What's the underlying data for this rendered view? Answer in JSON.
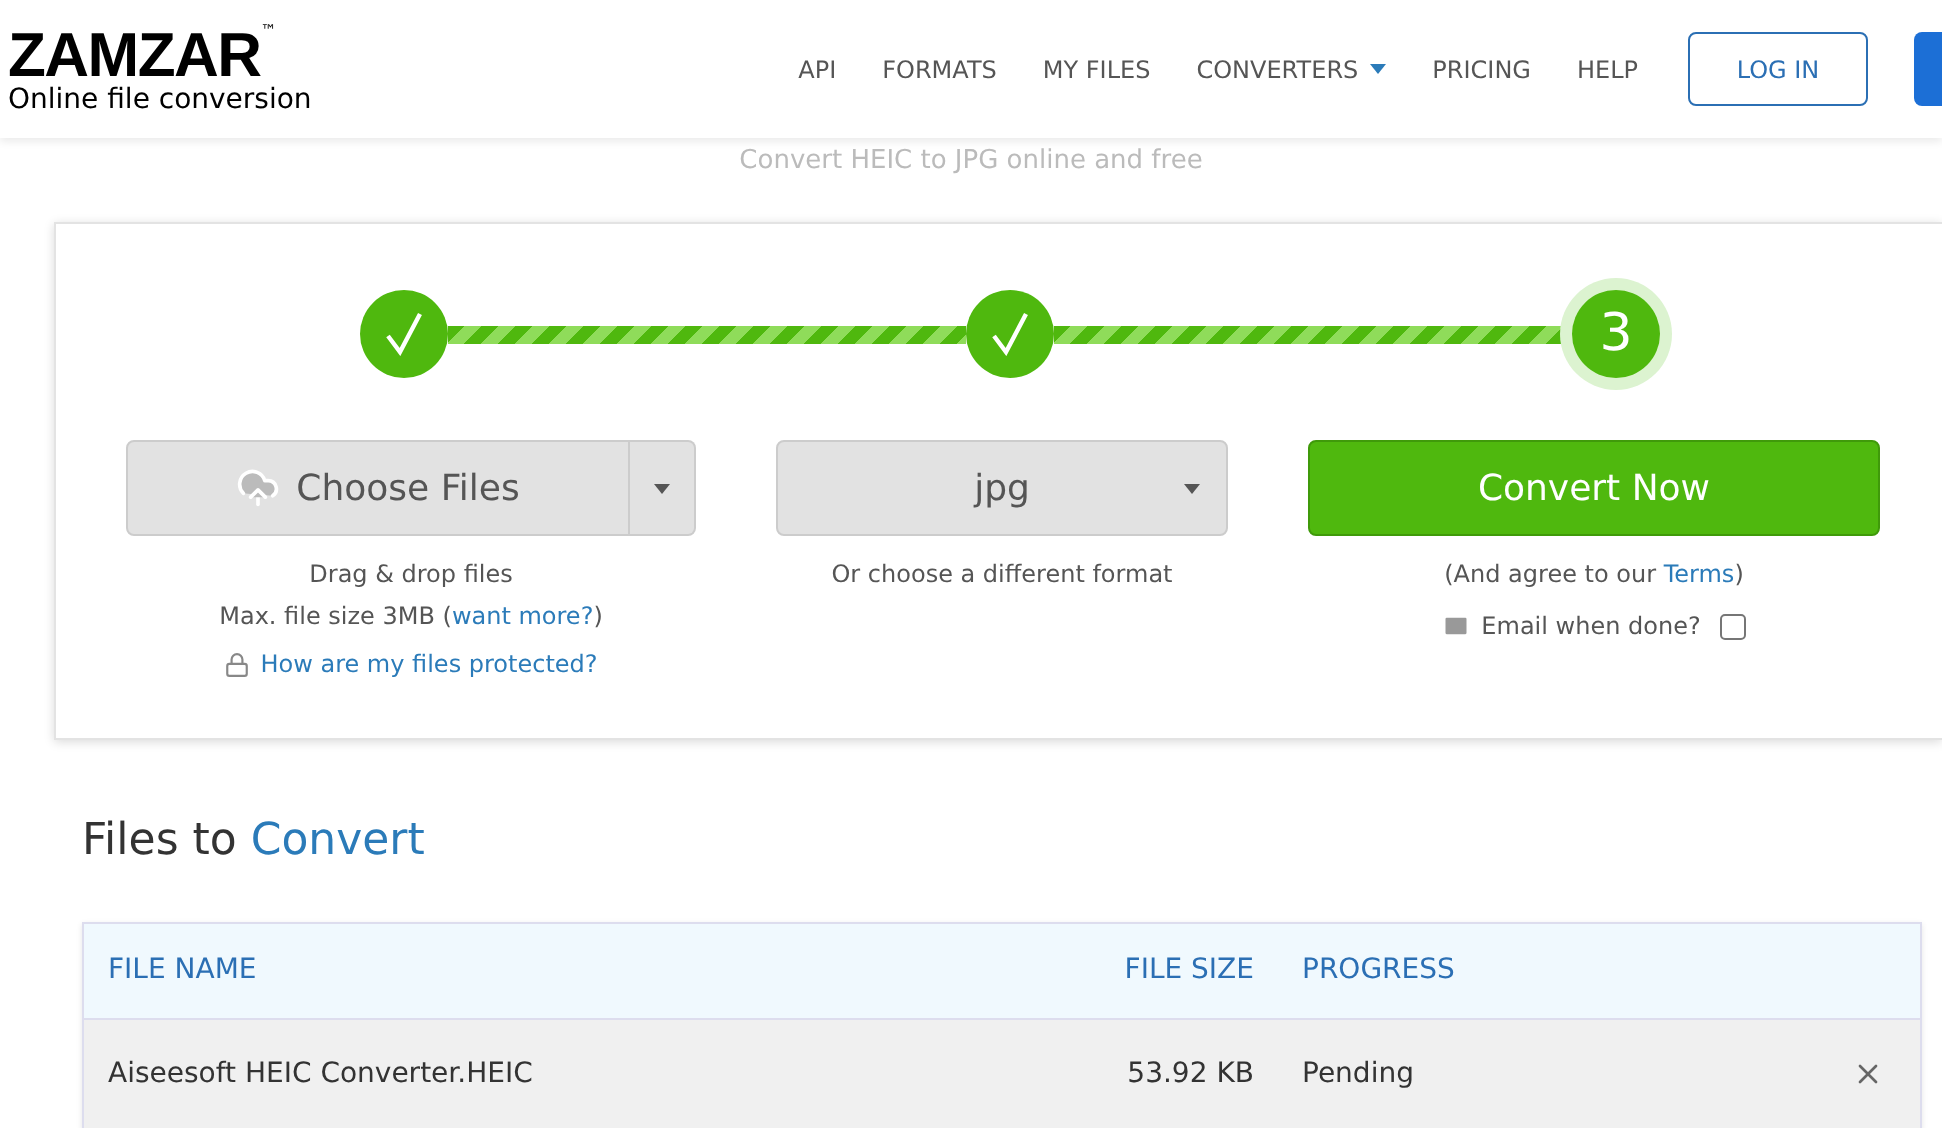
{
  "header": {
    "logo": "ZAMZAR",
    "logo_mark": "™",
    "tagline": "Online file conversion",
    "nav": [
      {
        "label": "API",
        "dropdown": false
      },
      {
        "label": "FORMATS",
        "dropdown": false
      },
      {
        "label": "MY FILES",
        "dropdown": false
      },
      {
        "label": "CONVERTERS",
        "dropdown": true
      },
      {
        "label": "PRICING",
        "dropdown": false
      },
      {
        "label": "HELP",
        "dropdown": false
      }
    ],
    "login": "LOG IN"
  },
  "subtitle": "Convert HEIC to JPG online and free",
  "steps": [
    {
      "done": true
    },
    {
      "done": true
    },
    {
      "done": false,
      "label": "3"
    }
  ],
  "upload": {
    "button": "Choose Files",
    "hint_1": "Drag & drop files",
    "hint_2": "Max. file size 3MB (",
    "hint_link": "want more?",
    "hint_end": ")",
    "protect_link": "How are my files protected?"
  },
  "format": {
    "value": "jpg",
    "hint": "Or choose a different format"
  },
  "convert": {
    "button": "Convert Now",
    "agree": "(And agree to our ",
    "terms": "Terms",
    "agree_end": ")",
    "email_label": "Email when done?",
    "email_checked": false
  },
  "files": {
    "title": "Files to ",
    "title_accent": "Convert",
    "columns": [
      "FILE NAME",
      "FILE SIZE",
      "PROGRESS"
    ],
    "rows": [
      {
        "name": "Aiseesoft HEIC Converter.HEIC",
        "size": "53.92 KB",
        "progress": "Pending"
      }
    ]
  }
}
